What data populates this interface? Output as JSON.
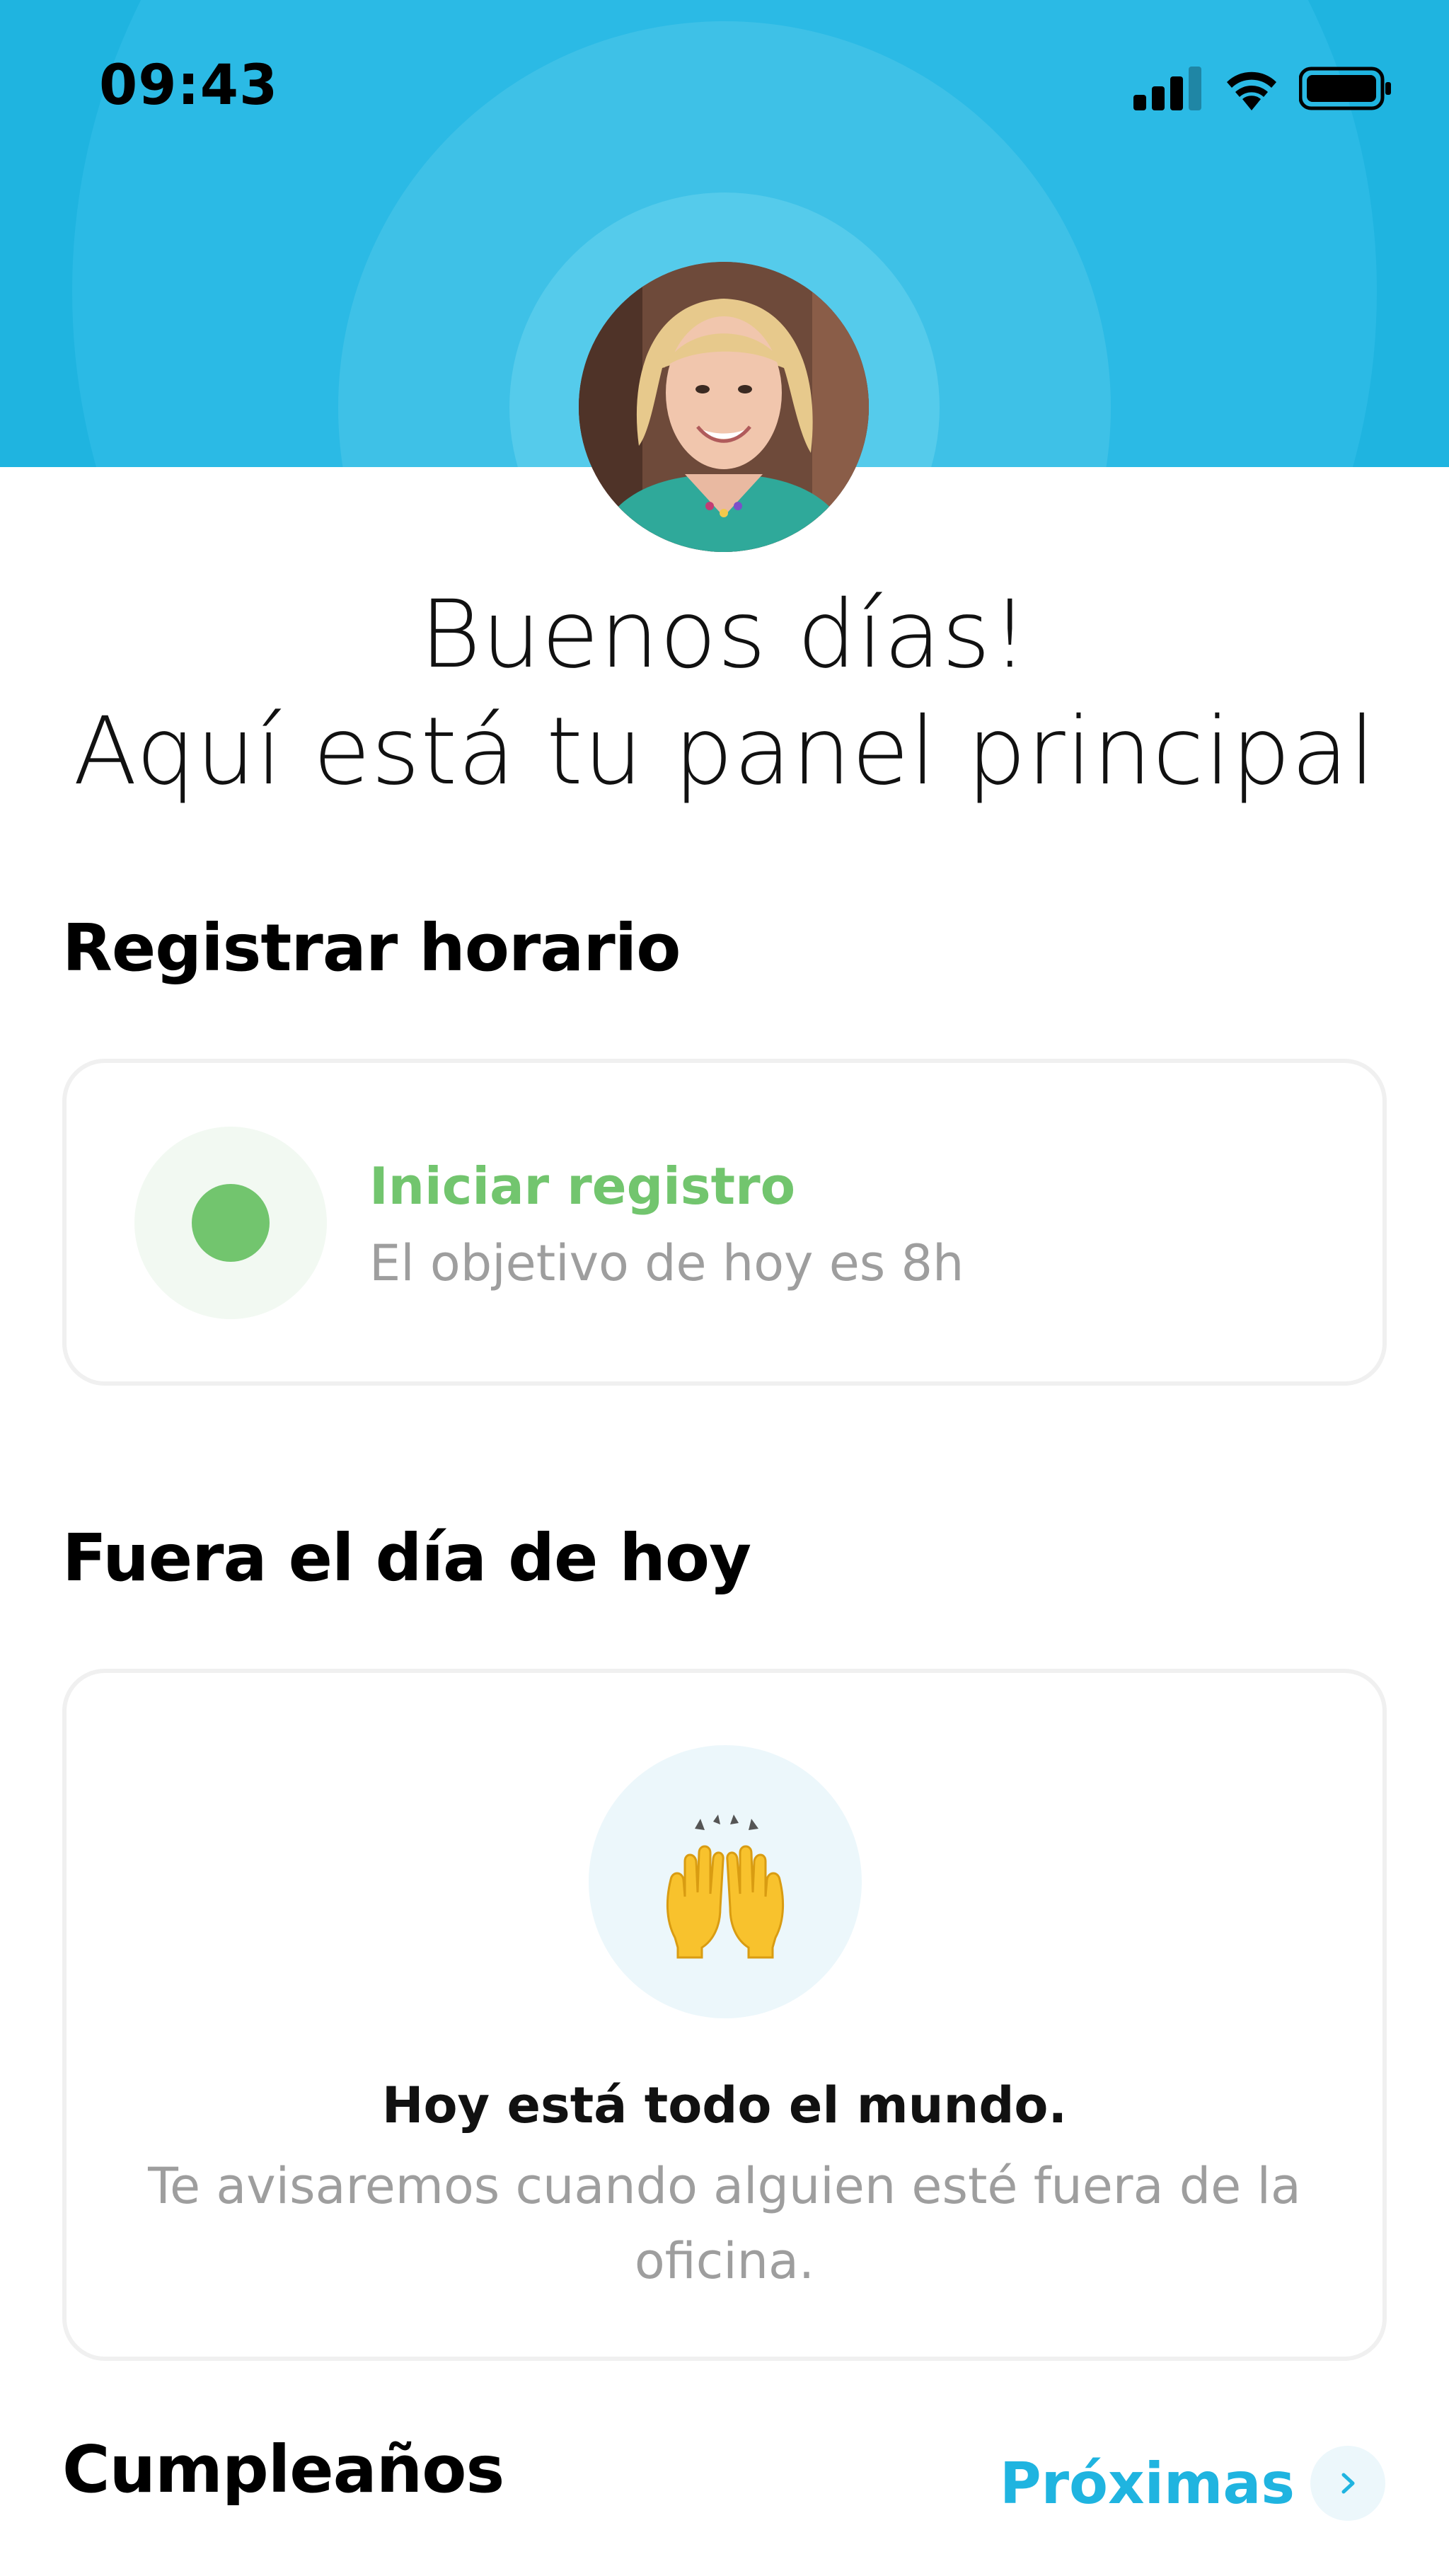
{
  "status_bar": {
    "time": "09:43"
  },
  "greeting": {
    "line1": "Buenos días!",
    "line2": "Aquí está tu panel principal"
  },
  "time_tracking": {
    "section_title": "Registrar horario",
    "action_label": "Iniciar registro",
    "goal_text": "El objetivo de hoy es 8h"
  },
  "out_today": {
    "section_title": "Fuera el día de hoy",
    "emoji_icon": "raising-hands-icon",
    "empty_title": "Hoy está todo el mundo.",
    "empty_message": "Te avisaremos cuando alguien esté fuera de la oficina."
  },
  "birthdays": {
    "section_title": "Cumpleaños",
    "upcoming_label": "Próximas"
  },
  "colors": {
    "header_blue": "#1fb4e0",
    "accent_green": "#72c56e",
    "muted_text": "#9e9e9e"
  }
}
